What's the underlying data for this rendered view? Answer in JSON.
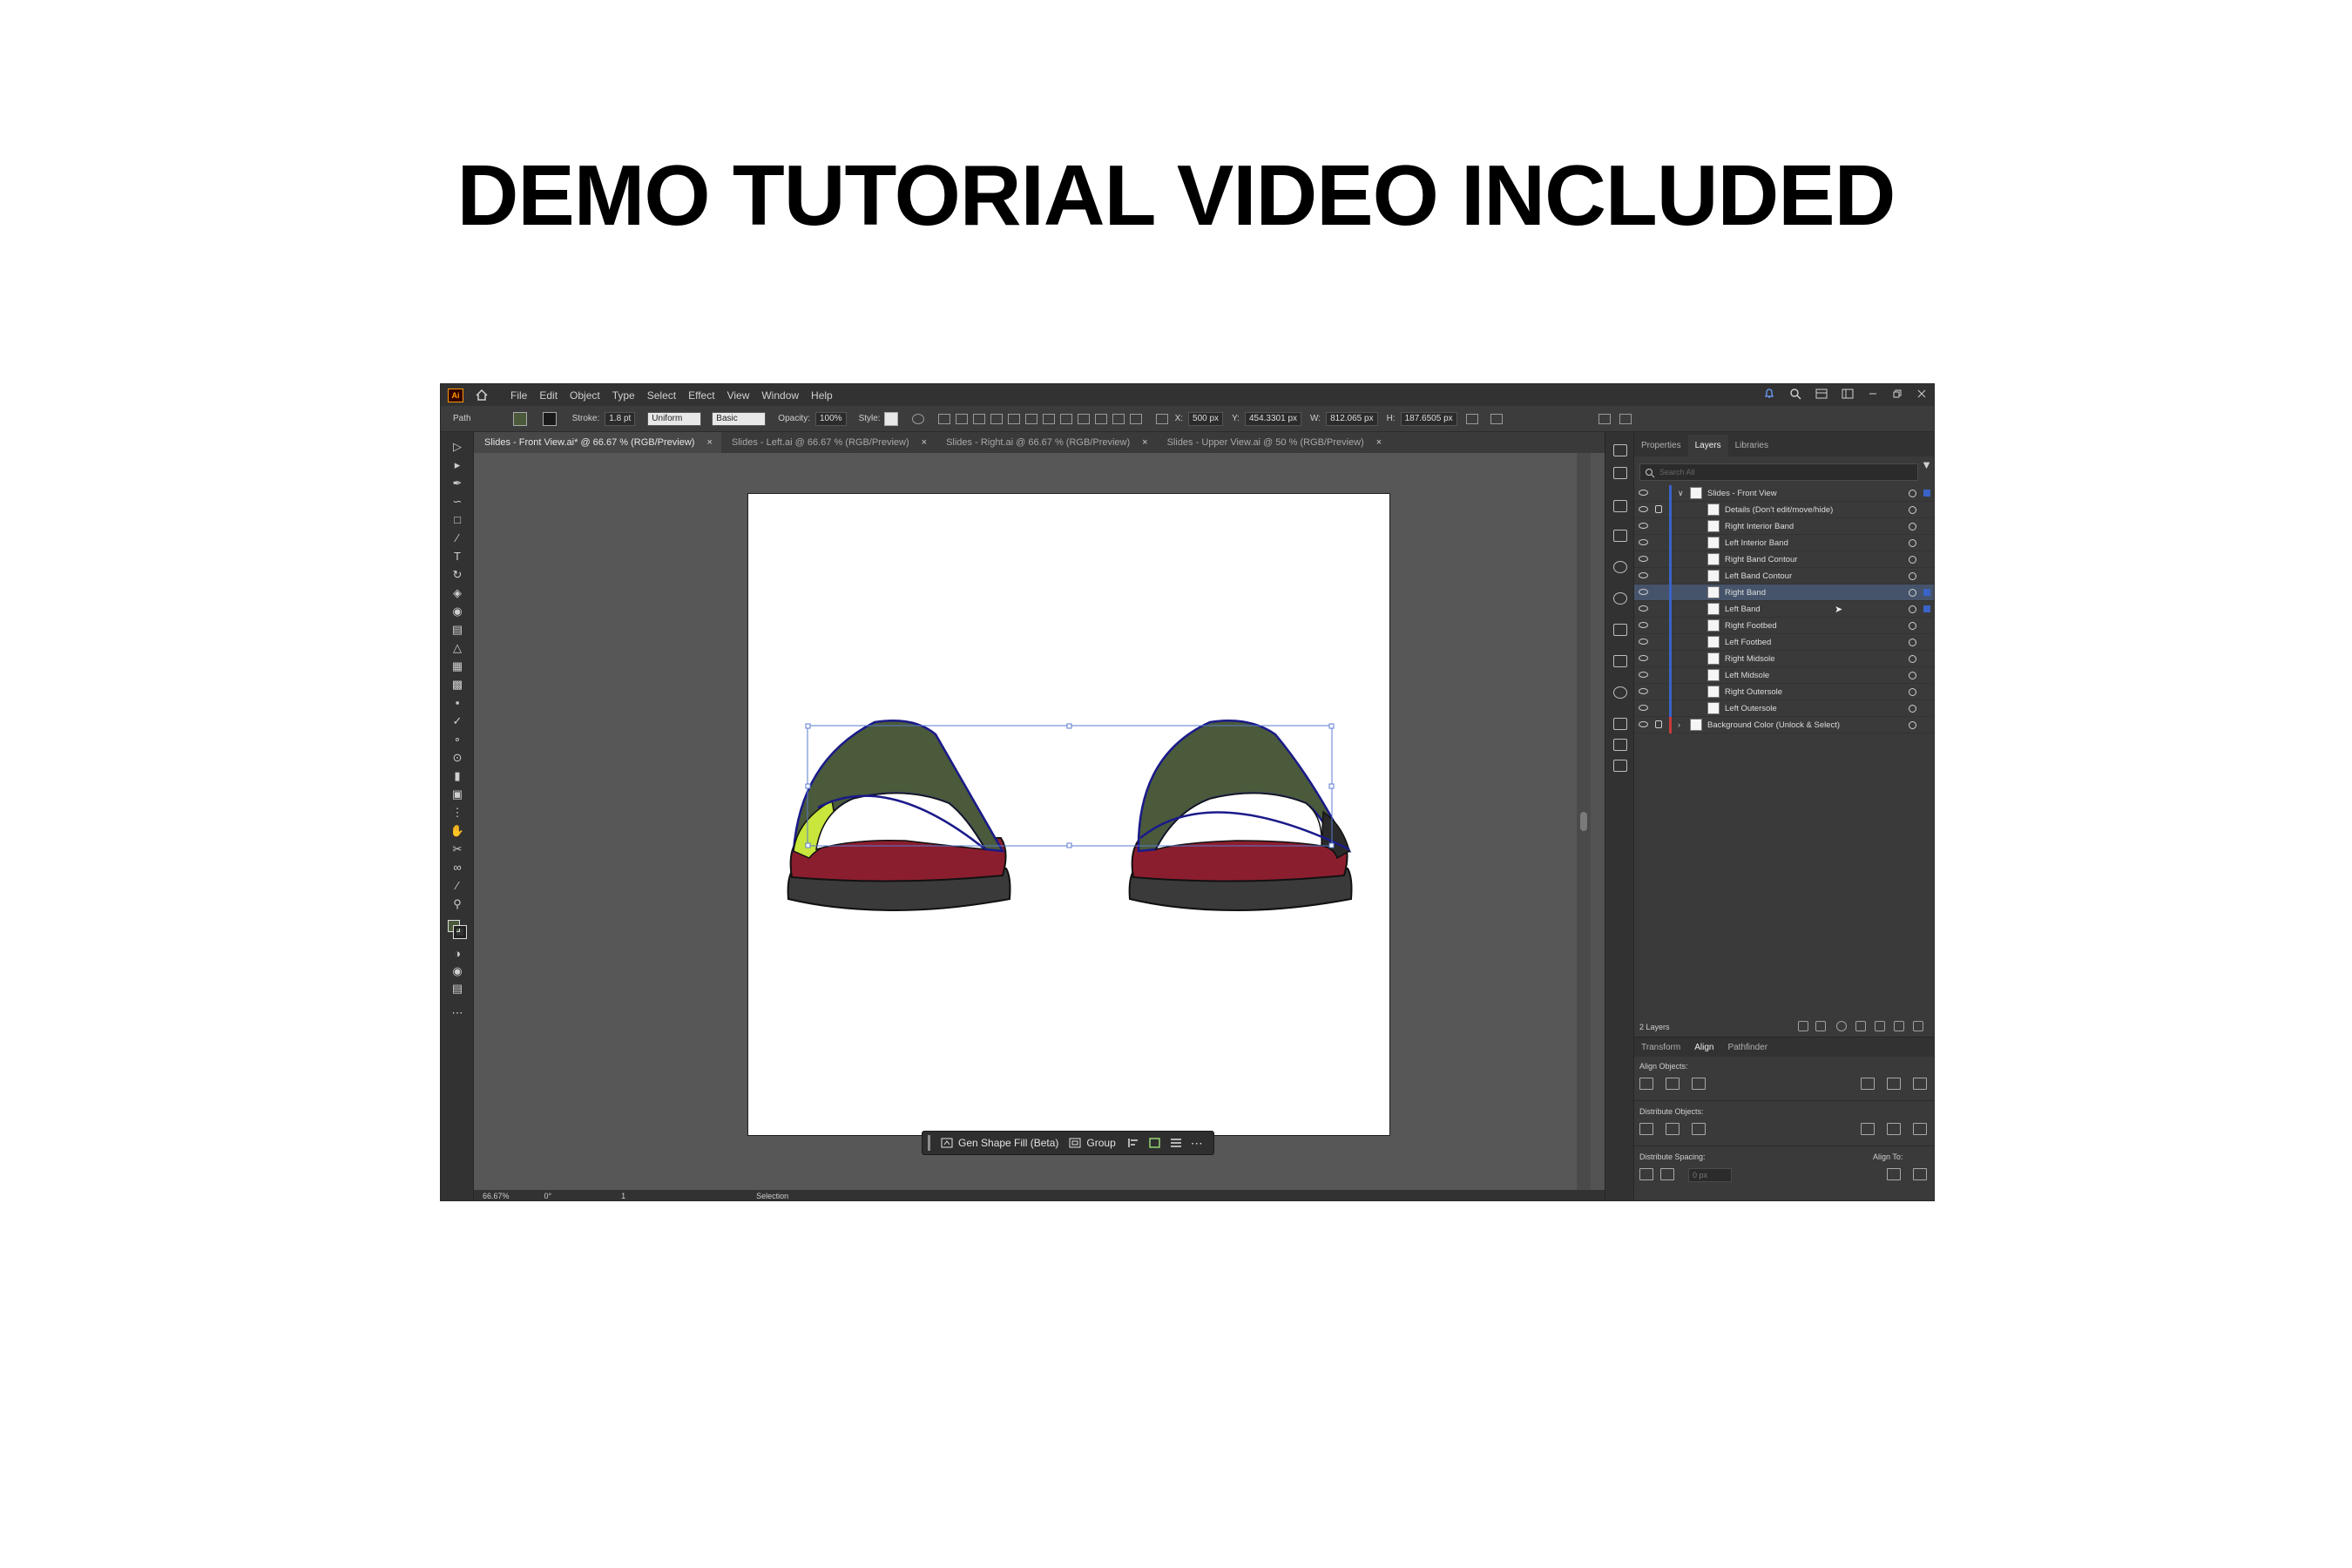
{
  "headline": "DEMO TUTORIAL VIDEO INCLUDED",
  "app": {
    "logo": "Ai",
    "menu": [
      "File",
      "Edit",
      "Object",
      "Type",
      "Select",
      "Effect",
      "View",
      "Window",
      "Help"
    ],
    "control_bar": {
      "selection_label": "Path",
      "stroke_label": "Stroke:",
      "stroke_value": "1.8 pt",
      "profile": "Uniform",
      "brush": "Basic",
      "opacity_label": "Opacity:",
      "opacity_value": "100%",
      "style_label": "Style:",
      "x_label": "X:",
      "x_value": "500 px",
      "y_label": "Y:",
      "y_value": "454.3301 px",
      "w_label": "W:",
      "w_value": "812.065 px",
      "h_label": "H:",
      "h_value": "187.6505 px"
    },
    "doc_tabs": [
      {
        "label": "Slides - Front View.ai* @ 66.67 % (RGB/Preview)"
      },
      {
        "label": "Slides - Left.ai @ 66.67 % (RGB/Preview)"
      },
      {
        "label": "Slides - Right.ai @ 66.67 % (RGB/Preview)"
      },
      {
        "label": "Slides - Upper View.ai @ 50 % (RGB/Preview)"
      }
    ],
    "context_bar": {
      "gen_fill": "Gen Shape Fill (Beta)",
      "group": "Group"
    },
    "status_bar": {
      "zoom": "66.67%",
      "rotation": "0°",
      "artboard": "1",
      "tool": "Selection"
    },
    "panel_tabs": [
      "Properties",
      "Layers",
      "Libraries"
    ],
    "search_placeholder": "Search All",
    "layers": [
      {
        "name": "Slides - Front View"
      },
      {
        "name": "Details (Don't edit/move/hide)"
      },
      {
        "name": "Right Interior Band"
      },
      {
        "name": "Left Interior Band"
      },
      {
        "name": "Right Band Contour"
      },
      {
        "name": "Left Band Contour"
      },
      {
        "name": "Right Band"
      },
      {
        "name": "Left Band"
      },
      {
        "name": "Right Footbed"
      },
      {
        "name": "Left Footbed"
      },
      {
        "name": "Right Midsole"
      },
      {
        "name": "Left Midsole"
      },
      {
        "name": "Right Outersole"
      },
      {
        "name": "Left Outersole"
      },
      {
        "name": "Background Color (Unlock & Select)"
      }
    ],
    "layers_count": "2 Layers",
    "align_tabs": [
      "Transform",
      "Align",
      "Pathfinder"
    ],
    "align_objects": "Align Objects:",
    "distribute_objects": "Distribute Objects:",
    "distribute_spacing": "Distribute Spacing:",
    "align_to": "Align To:",
    "spacing_value": "0 px"
  },
  "colors": {
    "band_green": "#4a5a3a",
    "footbed_red": "#8b1e2e",
    "sole_dark": "#3a3a3a",
    "accent_lime": "#c8e63c",
    "selection_blue": "#3a63c8"
  }
}
